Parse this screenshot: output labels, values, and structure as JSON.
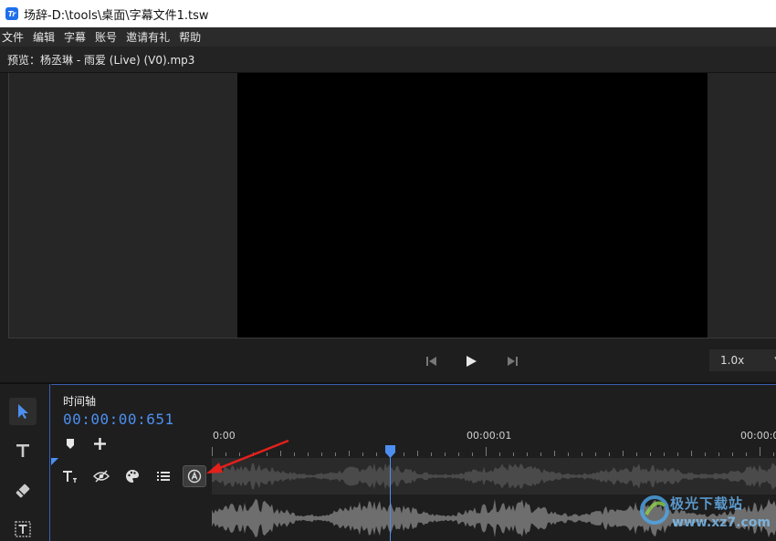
{
  "window": {
    "title": "场辞-D:\\tools\\桌面\\字幕文件1.tsw",
    "logo_text": "Tr"
  },
  "menu": [
    "文件",
    "编辑",
    "字幕",
    "账号",
    "邀请有礼",
    "帮助"
  ],
  "preview": {
    "label": "预览：杨丞琳 - 雨爱 (Live) (V0).mp3"
  },
  "playback": {
    "speed": "1.0x"
  },
  "tools": [
    {
      "name": "select",
      "active": true
    },
    {
      "name": "text",
      "active": false
    },
    {
      "name": "eraser",
      "active": false
    },
    {
      "name": "text-box",
      "active": false
    }
  ],
  "timeline": {
    "title": "时间轴",
    "current_time": "00:00:00:651",
    "ruler_labels": [
      "0:00",
      "00:00:01",
      "00:00:0"
    ]
  },
  "colors": {
    "accent": "#4d8ff0",
    "annotation": "#e3201b"
  },
  "watermark": {
    "line1": "极光下载站",
    "line2": "www.xz7.com"
  }
}
